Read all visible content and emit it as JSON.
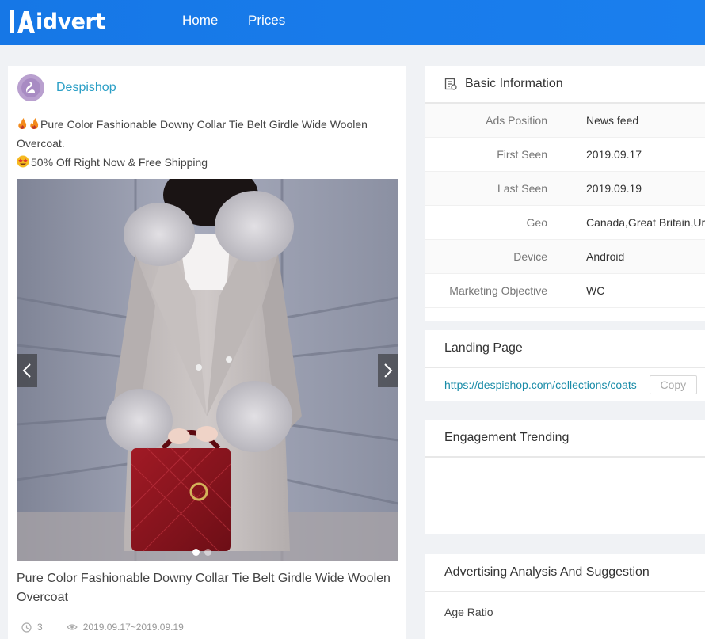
{
  "nav": {
    "logo_text": "idvert",
    "home_label": "Home",
    "prices_label": "Prices"
  },
  "ad": {
    "advertiser": "Despishop",
    "text_line1": "Pure Color Fashionable Downy Collar Tie Belt Girdle Wide Woolen Overcoat.",
    "text_line2": "50% Off Right Now & Free Shipping",
    "title": "Pure Color Fashionable Downy Collar Tie Belt Girdle Wide Woolen Overcoat",
    "count": "3",
    "date_range": "2019.09.17~2019.09.19"
  },
  "basic_info": {
    "heading": "Basic Information",
    "rows": [
      {
        "key": "Ads Position",
        "value": "News feed"
      },
      {
        "key": "First Seen",
        "value": "2019.09.17"
      },
      {
        "key": "Last Seen",
        "value": "2019.09.19"
      },
      {
        "key": "Geo",
        "value": "Canada,Great Britain,Ur"
      },
      {
        "key": "Device",
        "value": "Android"
      },
      {
        "key": "Marketing Objective",
        "value": "WC"
      }
    ]
  },
  "landing": {
    "heading": "Landing Page",
    "url": "https://despishop.com/collections/coats",
    "copy_label": "Copy"
  },
  "engagement": {
    "heading": "Engagement Trending"
  },
  "analysis": {
    "heading": "Advertising Analysis And Suggestion",
    "age_ratio_label": "Age Ratio"
  },
  "colors": {
    "nav_bg": "#1677e6",
    "link": "#2b9fc6",
    "url": "#1a8ca8"
  }
}
